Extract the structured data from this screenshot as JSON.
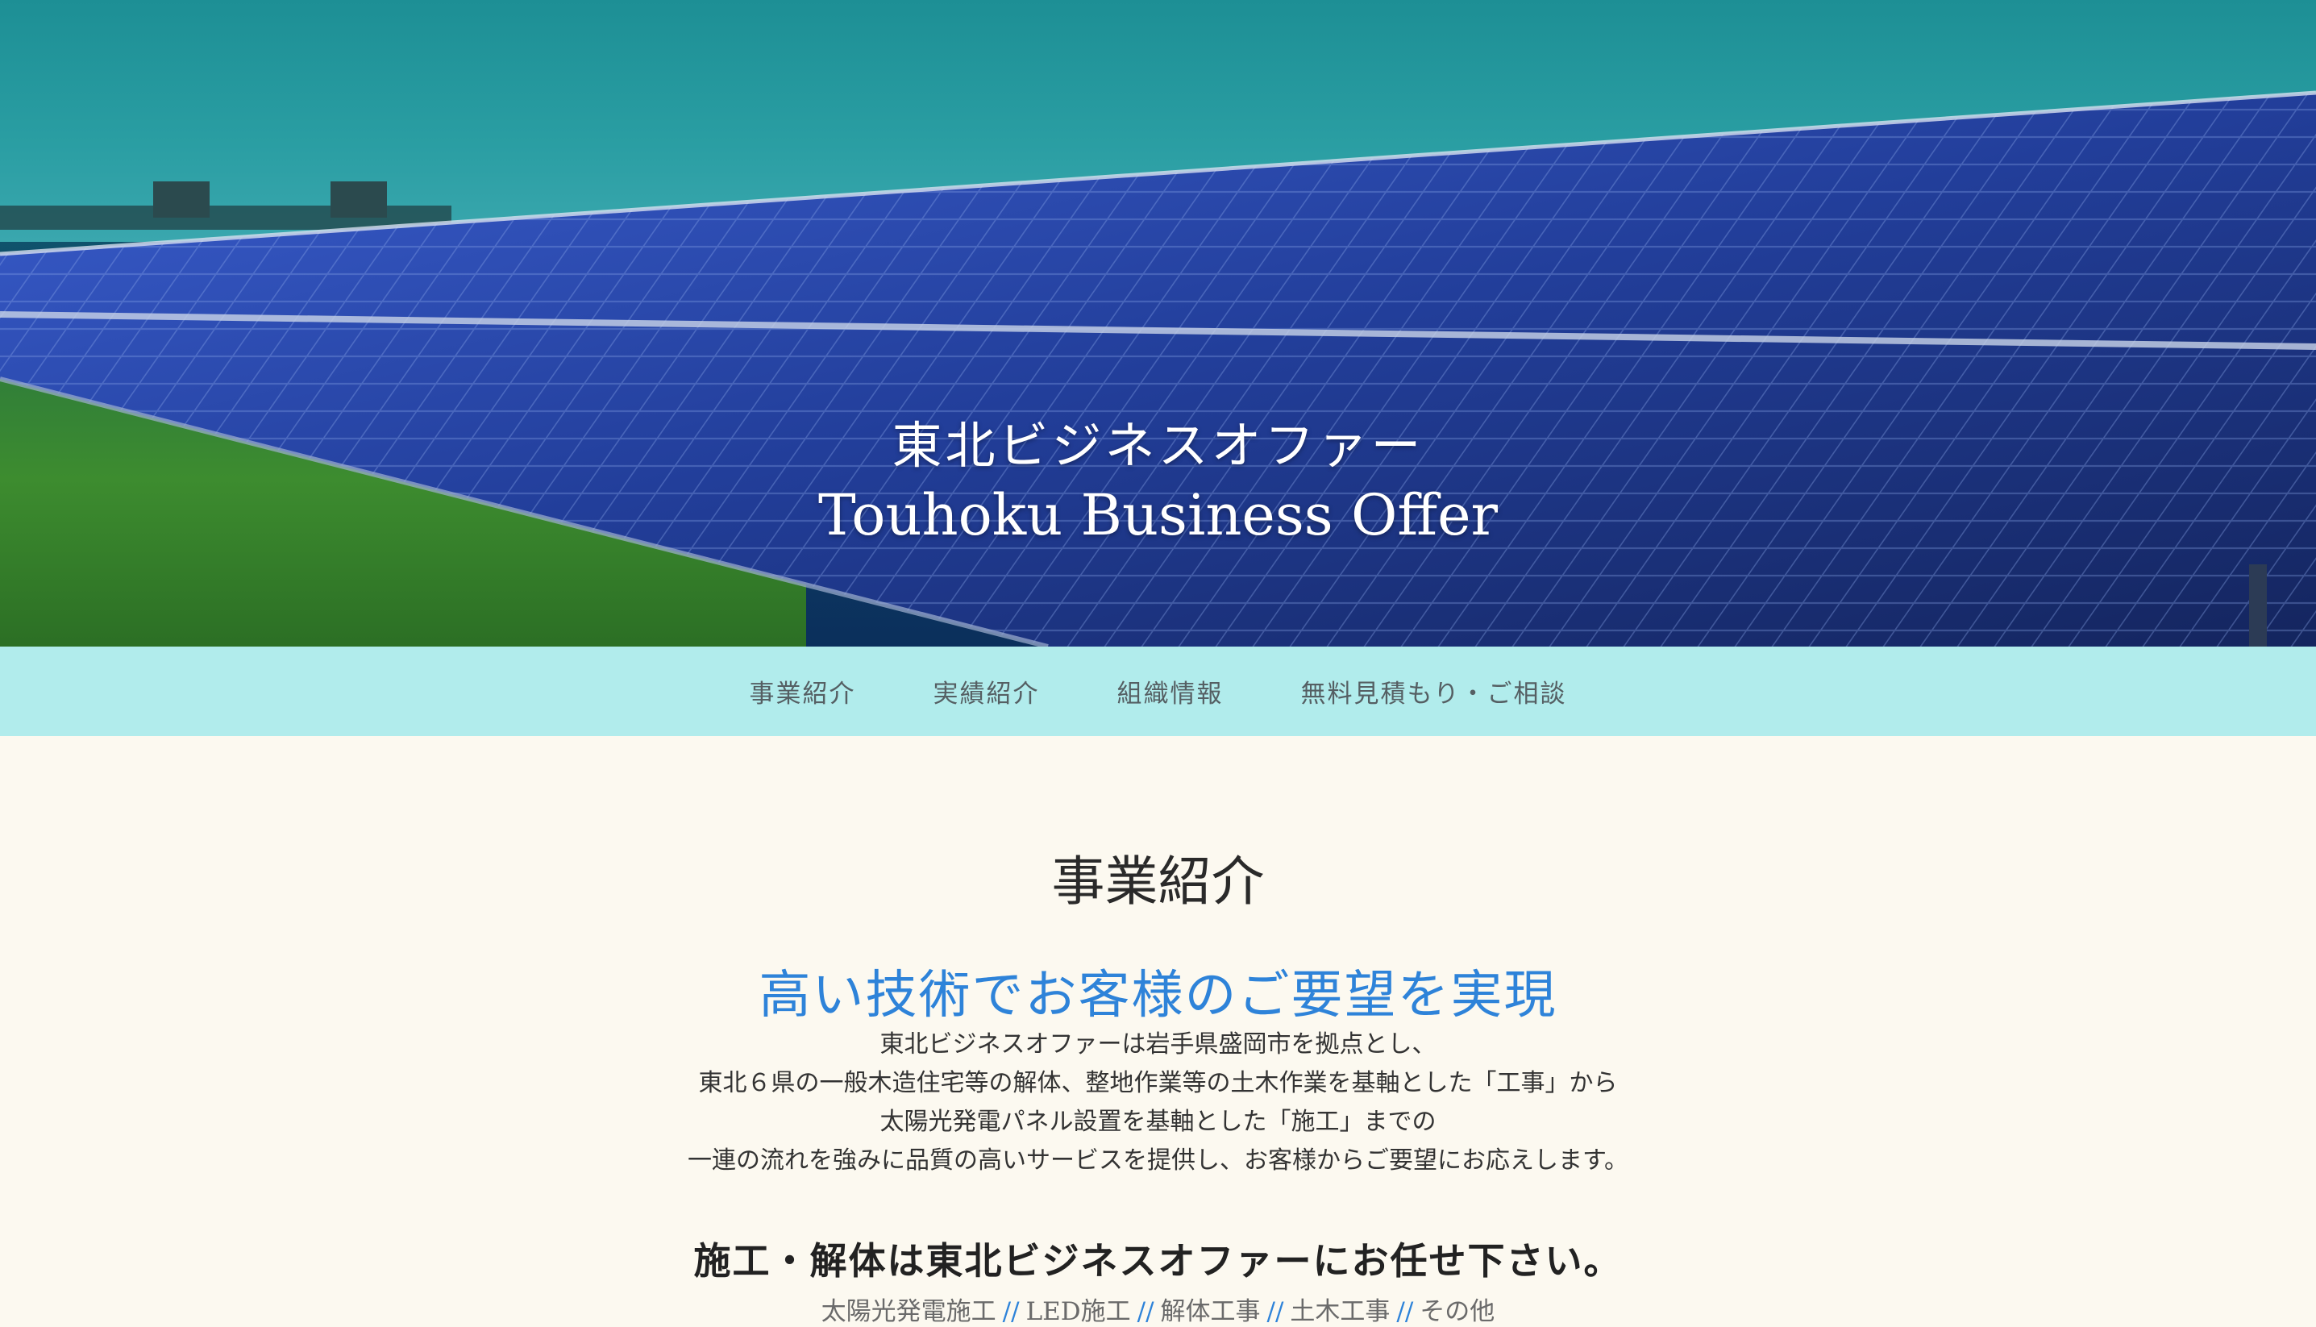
{
  "hero": {
    "title_jp": "東北ビジネスオファー",
    "title_en": "Touhoku Business Offer"
  },
  "nav": {
    "items": [
      {
        "label": "事業紹介"
      },
      {
        "label": "実績紹介"
      },
      {
        "label": "組織情報"
      },
      {
        "label": "無料見積もり・ご相談"
      }
    ]
  },
  "main": {
    "section_title": "事業紹介",
    "tagline": "高い技術でお客様のご要望を実現",
    "intro_lines": [
      "東北ビジネスオファーは岩手県盛岡市を拠点とし、",
      "東北６県の一般木造住宅等の解体、整地作業等の土木作業を基軸とした「工事」から",
      "太陽光発電パネル設置を基軸とした「施工」までの",
      "一連の流れを強みに品質の高いサービスを提供し、お客様からご要望にお応えします。"
    ],
    "subheading": "施工・解体は東北ビジネスオファーにお任せ下さい。",
    "services": [
      "太陽光発電施工",
      "LED施工",
      "解体工事",
      "土木工事",
      "その他"
    ],
    "separator": "//"
  },
  "colors": {
    "nav_bg": "#b1ecec",
    "page_bg": "#fcf9f0",
    "accent_blue": "#2e83d9"
  }
}
